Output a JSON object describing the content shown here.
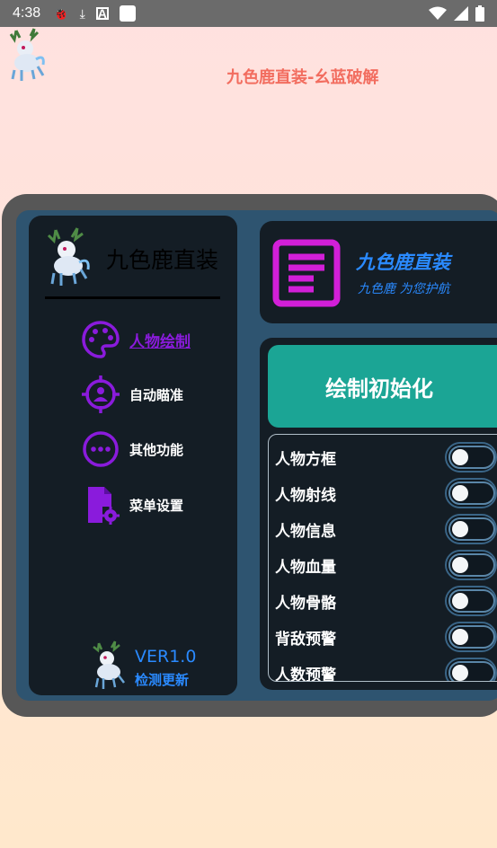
{
  "status_bar": {
    "time": "4:38"
  },
  "app": {
    "title": "九色鹿直装-幺蓝破解"
  },
  "sidebar": {
    "title": "九色鹿直装",
    "items": [
      {
        "label": "人物绘制",
        "icon": "palette-icon",
        "active": true
      },
      {
        "label": "自动瞄准",
        "icon": "crosshair-icon",
        "active": false
      },
      {
        "label": "其他功能",
        "icon": "more-icon",
        "active": false
      },
      {
        "label": "菜单设置",
        "icon": "settings-file-icon",
        "active": false
      }
    ],
    "version": "VER1.0",
    "update_label": "检测更新"
  },
  "header_card": {
    "title": "九色鹿直装",
    "subtitle": "九色鹿 为您护航"
  },
  "main": {
    "init_button": "绘制初始化",
    "toggles": [
      {
        "label": "人物方框",
        "on": false
      },
      {
        "label": "人物射线",
        "on": false
      },
      {
        "label": "人物信息",
        "on": false
      },
      {
        "label": "人物血量",
        "on": false
      },
      {
        "label": "人物骨骼",
        "on": false
      },
      {
        "label": "背敌预警",
        "on": false
      },
      {
        "label": "人数预警",
        "on": false
      }
    ]
  },
  "colors": {
    "accent_purple": "#8a1bdc",
    "accent_blue": "#2a8aff",
    "teal": "#1ba595",
    "panel": "#141d25",
    "title_red": "#f26d5f"
  }
}
